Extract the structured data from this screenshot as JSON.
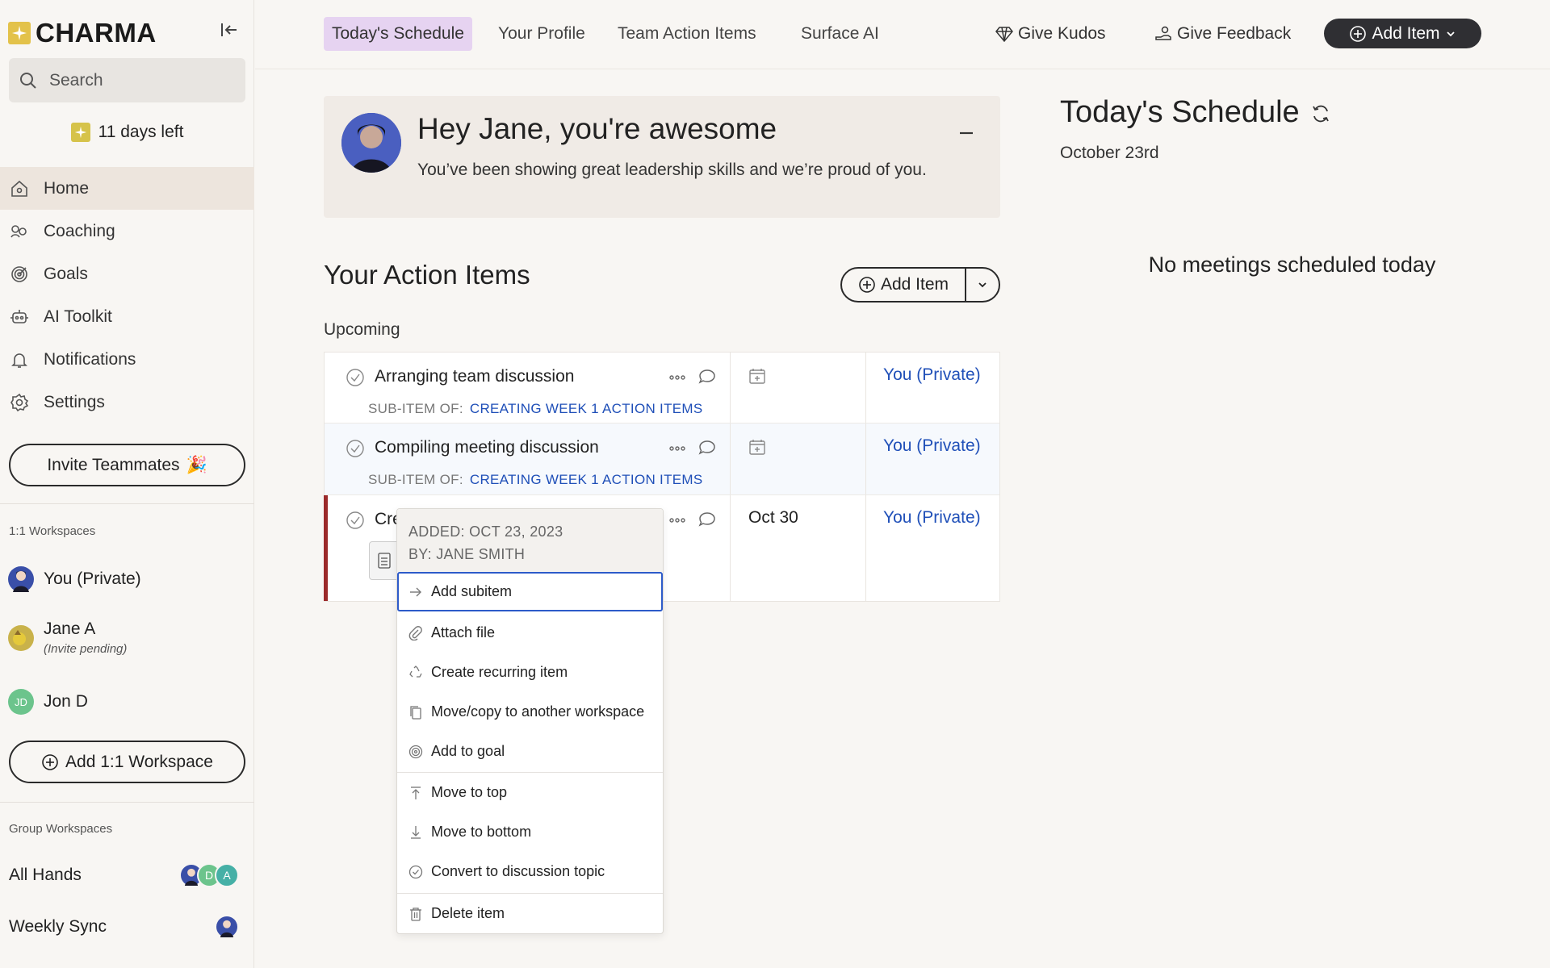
{
  "app": {
    "logo_text": "CHARMA"
  },
  "sidebar": {
    "search_placeholder": "Search",
    "trial_text": "11 days left",
    "nav": [
      {
        "label": "Home",
        "icon": "home-icon",
        "active": true
      },
      {
        "label": "Coaching",
        "icon": "coaching-icon"
      },
      {
        "label": "Goals",
        "icon": "target-icon"
      },
      {
        "label": "AI Toolkit",
        "icon": "robot-icon"
      },
      {
        "label": "Notifications",
        "icon": "bell-icon"
      },
      {
        "label": "Settings",
        "icon": "gear-icon"
      }
    ],
    "invite_label": "Invite Teammates",
    "invite_emoji": "🎉",
    "one_on_one_label": "1:1 Workspaces",
    "workspaces": [
      {
        "name": "You (Private)"
      },
      {
        "name": "Jane A",
        "sub": "(Invite pending)"
      },
      {
        "name": "Jon D",
        "initials": "JD"
      }
    ],
    "add_workspace_label": "Add 1:1 Workspace",
    "group_label": "Group Workspaces",
    "groups": [
      {
        "name": "All Hands",
        "avatars": [
          "",
          "D",
          "A"
        ]
      },
      {
        "name": "Weekly Sync",
        "avatars": [
          ""
        ]
      }
    ]
  },
  "topnav": {
    "tabs": [
      "Today's Schedule",
      "Your Profile",
      "Team Action Items",
      "Surface AI"
    ],
    "active_tab": 0,
    "give_kudos": "Give Kudos",
    "give_feedback": "Give Feedback",
    "add_item": "Add Item"
  },
  "kudos": {
    "title": "Hey Jane, you're awesome",
    "message": "You’ve been showing great leadership skills and we’re proud of you."
  },
  "action_items": {
    "title": "Your Action Items",
    "add_label": "Add Item",
    "section": "Upcoming",
    "sub_item_prefix": "SUB-ITEM OF:",
    "rows": [
      {
        "title": "Arranging team discussion",
        "parent": "CREATING WEEK 1 ACTION ITEMS",
        "due": "",
        "owner": "You (Private)"
      },
      {
        "title": "Compiling meeting discussion",
        "parent": "CREATING WEEK 1 ACTION ITEMS",
        "due": "",
        "owner": "You (Private)"
      },
      {
        "title": "Cre",
        "due": "Oct 30",
        "owner": "You (Private)"
      }
    ]
  },
  "context_menu": {
    "added": "ADDED: OCT 23, 2023",
    "by": "BY: JANE SMITH",
    "items": [
      {
        "label": "Add subitem",
        "icon": "arrow-right-icon"
      },
      {
        "label": "Attach file",
        "icon": "paperclip-icon"
      },
      {
        "label": "Create recurring item",
        "icon": "recycle-icon"
      },
      {
        "label": "Move/copy to another workspace",
        "icon": "copy-icon"
      },
      {
        "label": "Add to goal",
        "icon": "target-icon"
      },
      {
        "label": "Move to top",
        "icon": "move-top-icon"
      },
      {
        "label": "Move to bottom",
        "icon": "move-bottom-icon"
      },
      {
        "label": "Convert to discussion topic",
        "icon": "check-circle-icon"
      },
      {
        "label": "Delete item",
        "icon": "trash-icon"
      }
    ]
  },
  "schedule": {
    "title": "Today's Schedule",
    "date": "October 23rd",
    "empty": "No meetings scheduled today"
  },
  "colors": {
    "accent_tab": "#e6d3f1",
    "link_blue": "#1f4fb8",
    "dark_button": "#2f2f33",
    "focus_ring": "#2d5bc9",
    "overdue_bar": "#9b2a2a"
  }
}
